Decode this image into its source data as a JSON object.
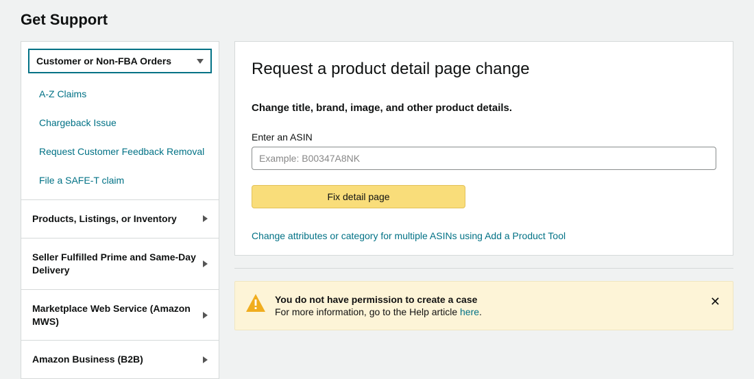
{
  "header": {
    "title": "Get Support"
  },
  "sidebar": {
    "dropdown_label": "Customer or Non-FBA Orders",
    "sub_items": [
      {
        "label": "A-Z Claims"
      },
      {
        "label": "Chargeback Issue"
      },
      {
        "label": "Request Customer Feedback Removal"
      },
      {
        "label": "File a SAFE-T claim"
      }
    ],
    "categories": [
      {
        "label": "Products, Listings, or Inventory"
      },
      {
        "label": "Seller Fulfilled Prime and Same-Day Delivery"
      },
      {
        "label": "Marketplace Web Service (Amazon MWS)"
      },
      {
        "label": "Amazon Business (B2B)"
      }
    ]
  },
  "main": {
    "heading": "Request a product detail page change",
    "subheading": "Change title, brand, image, and other product details.",
    "field_label": "Enter an ASIN",
    "asin_placeholder": "Example: B00347A8NK",
    "asin_value": "",
    "button_label": "Fix detail page",
    "bottom_link": "Change attributes or category for multiple ASINs using Add a Product Tool"
  },
  "alert": {
    "title": "You do not have permission to create a case",
    "body_prefix": "For more information, go to the Help article ",
    "link_text": "here",
    "body_suffix": "."
  }
}
